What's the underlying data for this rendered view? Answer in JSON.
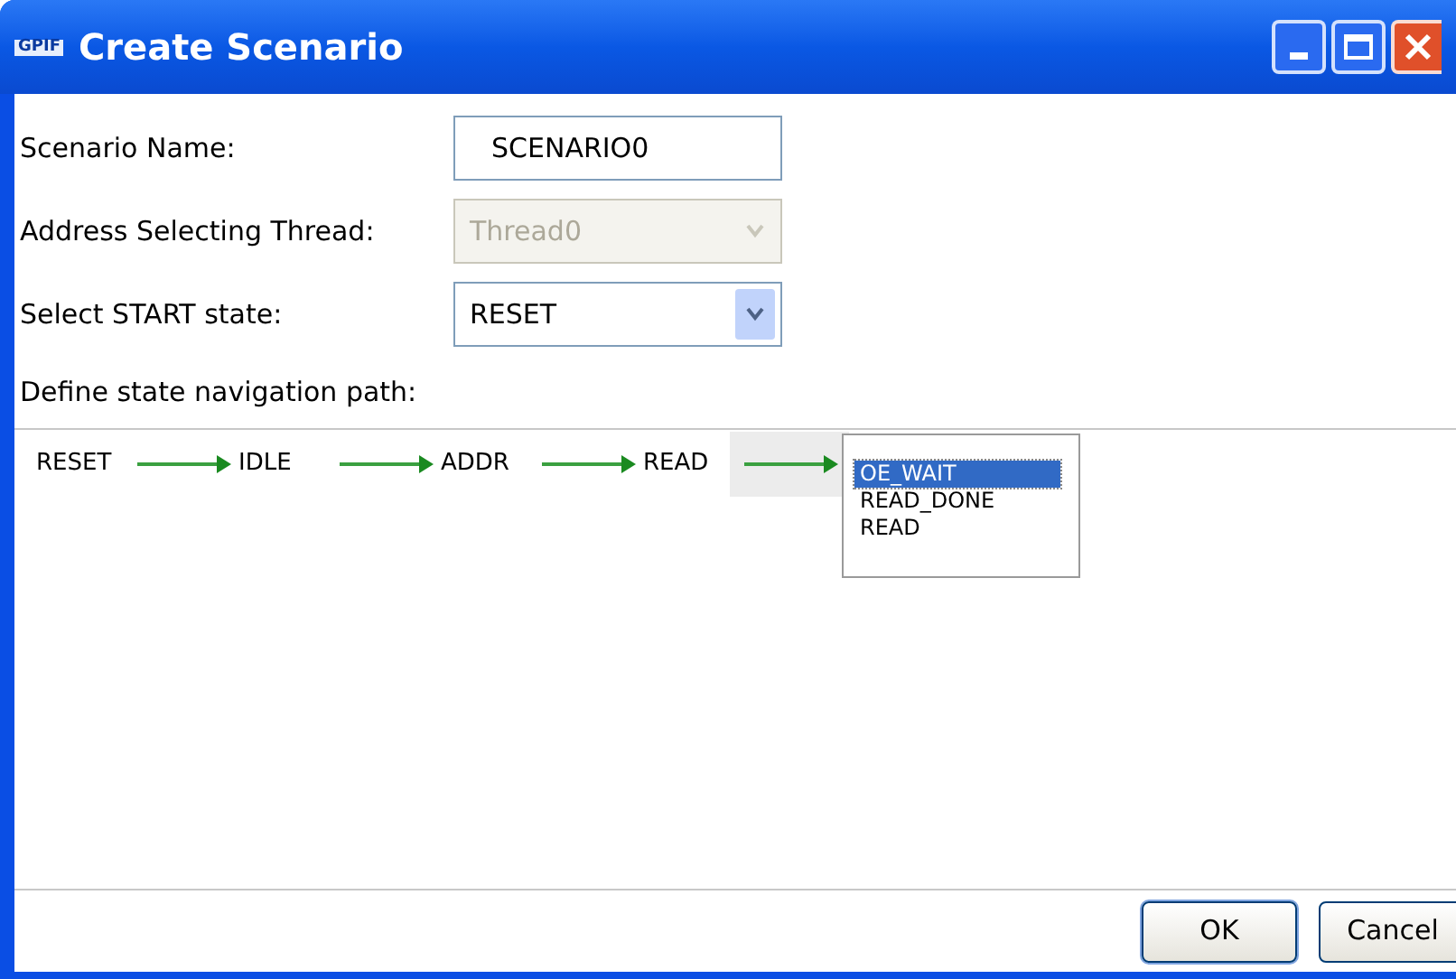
{
  "window": {
    "title": "Create Scenario",
    "icon_text": "GPIF"
  },
  "fields": [
    {
      "kind": "text",
      "label": "Scenario Name:",
      "value": "SCENARIO0",
      "disabled": false
    },
    {
      "kind": "combo",
      "label": "Address Selecting Thread:",
      "value": "Thread0",
      "disabled": true
    },
    {
      "kind": "combo",
      "label": "Select START state:",
      "value": "RESET",
      "disabled": false
    }
  ],
  "path_label": "Define state navigation path:",
  "path": [
    "RESET",
    "IDLE",
    "ADDR",
    "READ"
  ],
  "next_state_options": [
    {
      "label": "OE_WAIT",
      "selected": true
    },
    {
      "label": "READ_DONE",
      "selected": false
    },
    {
      "label": "READ",
      "selected": false
    }
  ],
  "buttons": [
    "OK",
    "Cancel"
  ]
}
